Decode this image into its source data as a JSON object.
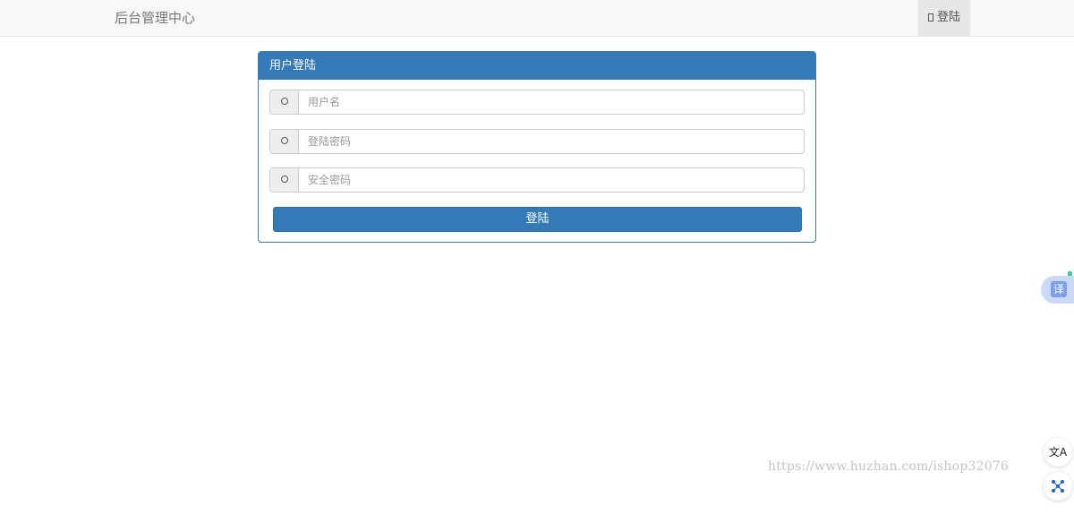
{
  "navbar": {
    "brand": "后台管理中心",
    "login_link": "登陆"
  },
  "login_panel": {
    "title": "用户登陆",
    "username_placeholder": "用户名",
    "password_placeholder": "登陆密码",
    "security_password_placeholder": "安全密码",
    "submit_label": "登陆"
  },
  "overlay": {
    "translate_label": "译",
    "float_translate_glyph": "文A",
    "watermark": "https://www.huzhan.com/ishop32076"
  },
  "colors": {
    "primary": "#337ab7",
    "navbar_bg": "#f8f8f8",
    "addon_bg": "#eeeeee",
    "accent_green": "#3cc8a8"
  },
  "icons": {
    "nav_login": "login-icon",
    "username": "user-icon",
    "password": "lock-icon",
    "security": "key-icon"
  }
}
